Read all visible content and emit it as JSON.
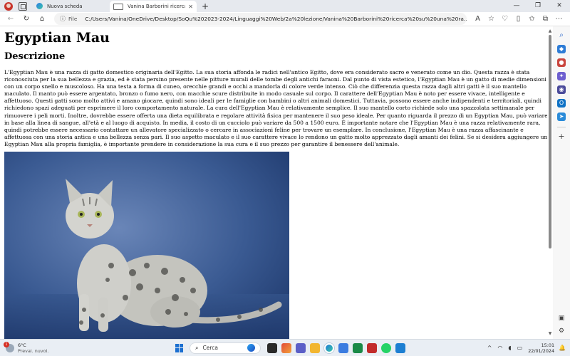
{
  "browser": {
    "tabs": [
      {
        "title": "Nuova scheda",
        "active": false
      },
      {
        "title": "Vanina Barborini ricerca su una r",
        "active": true
      }
    ],
    "new_tab_symbol": "+",
    "window_controls": {
      "minimize": "—",
      "maximize": "❐",
      "close": "✕"
    },
    "address": {
      "scheme_label": "File",
      "url": "C:/Users/Vanina/OneDrive/Desktop/SoQu%202023-2024/Linguaggi%20Web/2a%20lezione/Vanina%20Barborini%20ricerca%20su%20una%20ra..."
    }
  },
  "page": {
    "title": "Egyptian Mau",
    "section_heading": "Descrizione",
    "paragraph": "L'Egyptian Mau è una razza di gatto domestico originaria dell'Egitto. La sua storia affonda le radici nell'antico Egitto, dove era considerato sacro e venerato come un dio. Questa razza è stata riconosciuta per la sua bellezza e grazia, ed è stata persino presente nelle pitture murali delle tombe degli antichi faraoni. Dal punto di vista estetico, l'Egyptian Mau è un gatto di medie dimensioni con un corpo snello e muscoloso. Ha una testa a forma di cuneo, orecchie grandi e occhi a mandorla di colore verde intenso. Ciò che differenzia questa razza dagli altri gatti è il suo mantello maculato. Il manto può essere argentato, bronzo o fumo nero, con macchie scure distribuite in modo casuale sul corpo. Il carattere dell'Egyptian Mau è noto per essere vivace, intelligente e affettuoso. Questi gatti sono molto attivi e amano giocare, quindi sono ideali per le famiglie con bambini o altri animali domestici. Tuttavia, possono essere anche indipendenti e territoriali, quindi richiedono spazi adeguati per esprimere il loro comportamento naturale. La cura dell'Egyptian Mau è relativamente semplice. Il suo mantello corto richiede solo una spazzolata settimanale per rimuovere i peli morti. Inoltre, dovrebbe essere offerta una dieta equilibrata e regolare attività fisica per mantenere il suo peso ideale. Per quanto riguarda il prezzo di un Egyptian Mau, può variare in base alla linea di sangue, all'età e al luogo di acquisto. In media, il costo di un cucciolo può variare da 500 a 1500 euro. È importante notare che l'Egyptian Mau è una razza relativamente rara, quindi potrebbe essere necessario contattare un allevatore specializzato o cercare in associazioni feline per trovare un esemplare. In conclusione, l'Egyptian Mau è una razza affascinante e affettuosa con una storia antica e una bellezza senza pari. Il suo aspetto maculato e il suo carattere vivace lo rendono un gatto molto apprezzato dagli amanti dei felini. Se si desidera aggiungere un Egyptian Mau alla propria famiglia, è importante prendere in considerazione la sua cura e il suo prezzo per garantire il benessere dell'animale."
  },
  "taskbar": {
    "weather": {
      "temperature": "6°C",
      "condition": "Preval. nuvol.",
      "badge": "1"
    },
    "search_placeholder": "Cerca",
    "clock": {
      "time": "15:01",
      "date": "22/01/2024"
    }
  },
  "colors": {
    "photo_backdrop": "#2f4f86",
    "accent": "#1b6fd0"
  }
}
